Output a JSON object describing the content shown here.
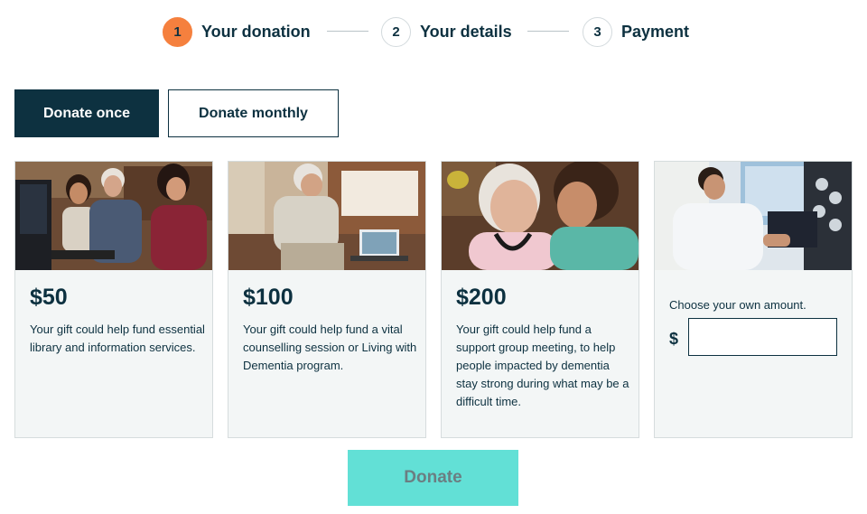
{
  "steps": [
    {
      "number": "1",
      "label": "Your donation",
      "active": true
    },
    {
      "number": "2",
      "label": "Your details",
      "active": false
    },
    {
      "number": "3",
      "label": "Payment",
      "active": false
    }
  ],
  "frequency_tabs": {
    "once": "Donate once",
    "monthly": "Donate monthly",
    "selected": "once"
  },
  "cards": [
    {
      "amount": "$50",
      "description": "Your gift could help fund essential library and information services.",
      "image": "people-at-computer-photo"
    },
    {
      "amount": "$100",
      "description": "Your gift could help fund a vital counselling session or Living with Dementia program.",
      "image": "man-video-call-photo"
    },
    {
      "amount": "$200",
      "description": "Your gift could help fund a support group meeting, to help people impacted by dementia stay strong during what may be a difficult time.",
      "image": "carer-and-elderly-woman-photo"
    }
  ],
  "custom_amount": {
    "label": "Choose your own amount.",
    "currency_symbol": "$",
    "value": "",
    "image": "doctor-reviewing-scans-photo"
  },
  "donate_button": "Donate",
  "colors": {
    "navy": "#0d3140",
    "orange_accent": "#f5803e",
    "teal_button": "#62e0d6",
    "card_bg": "#f3f6f6"
  }
}
